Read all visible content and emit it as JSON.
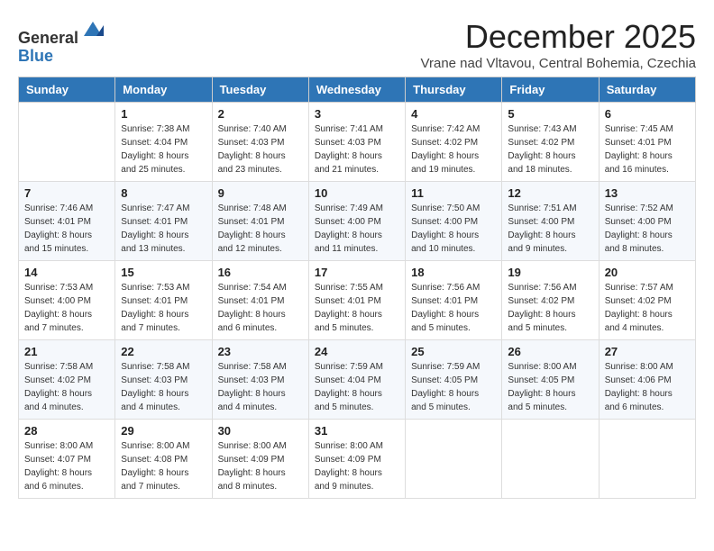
{
  "header": {
    "logo_line1": "General",
    "logo_line2": "Blue",
    "month_title": "December 2025",
    "subtitle": "Vrane nad Vltavou, Central Bohemia, Czechia"
  },
  "days_of_week": [
    "Sunday",
    "Monday",
    "Tuesday",
    "Wednesday",
    "Thursday",
    "Friday",
    "Saturday"
  ],
  "weeks": [
    [
      {
        "day": "",
        "info": ""
      },
      {
        "day": "1",
        "info": "Sunrise: 7:38 AM\nSunset: 4:04 PM\nDaylight: 8 hours\nand 25 minutes."
      },
      {
        "day": "2",
        "info": "Sunrise: 7:40 AM\nSunset: 4:03 PM\nDaylight: 8 hours\nand 23 minutes."
      },
      {
        "day": "3",
        "info": "Sunrise: 7:41 AM\nSunset: 4:03 PM\nDaylight: 8 hours\nand 21 minutes."
      },
      {
        "day": "4",
        "info": "Sunrise: 7:42 AM\nSunset: 4:02 PM\nDaylight: 8 hours\nand 19 minutes."
      },
      {
        "day": "5",
        "info": "Sunrise: 7:43 AM\nSunset: 4:02 PM\nDaylight: 8 hours\nand 18 minutes."
      },
      {
        "day": "6",
        "info": "Sunrise: 7:45 AM\nSunset: 4:01 PM\nDaylight: 8 hours\nand 16 minutes."
      }
    ],
    [
      {
        "day": "7",
        "info": "Sunrise: 7:46 AM\nSunset: 4:01 PM\nDaylight: 8 hours\nand 15 minutes."
      },
      {
        "day": "8",
        "info": "Sunrise: 7:47 AM\nSunset: 4:01 PM\nDaylight: 8 hours\nand 13 minutes."
      },
      {
        "day": "9",
        "info": "Sunrise: 7:48 AM\nSunset: 4:01 PM\nDaylight: 8 hours\nand 12 minutes."
      },
      {
        "day": "10",
        "info": "Sunrise: 7:49 AM\nSunset: 4:00 PM\nDaylight: 8 hours\nand 11 minutes."
      },
      {
        "day": "11",
        "info": "Sunrise: 7:50 AM\nSunset: 4:00 PM\nDaylight: 8 hours\nand 10 minutes."
      },
      {
        "day": "12",
        "info": "Sunrise: 7:51 AM\nSunset: 4:00 PM\nDaylight: 8 hours\nand 9 minutes."
      },
      {
        "day": "13",
        "info": "Sunrise: 7:52 AM\nSunset: 4:00 PM\nDaylight: 8 hours\nand 8 minutes."
      }
    ],
    [
      {
        "day": "14",
        "info": "Sunrise: 7:53 AM\nSunset: 4:00 PM\nDaylight: 8 hours\nand 7 minutes."
      },
      {
        "day": "15",
        "info": "Sunrise: 7:53 AM\nSunset: 4:01 PM\nDaylight: 8 hours\nand 7 minutes."
      },
      {
        "day": "16",
        "info": "Sunrise: 7:54 AM\nSunset: 4:01 PM\nDaylight: 8 hours\nand 6 minutes."
      },
      {
        "day": "17",
        "info": "Sunrise: 7:55 AM\nSunset: 4:01 PM\nDaylight: 8 hours\nand 5 minutes."
      },
      {
        "day": "18",
        "info": "Sunrise: 7:56 AM\nSunset: 4:01 PM\nDaylight: 8 hours\nand 5 minutes."
      },
      {
        "day": "19",
        "info": "Sunrise: 7:56 AM\nSunset: 4:02 PM\nDaylight: 8 hours\nand 5 minutes."
      },
      {
        "day": "20",
        "info": "Sunrise: 7:57 AM\nSunset: 4:02 PM\nDaylight: 8 hours\nand 4 minutes."
      }
    ],
    [
      {
        "day": "21",
        "info": "Sunrise: 7:58 AM\nSunset: 4:02 PM\nDaylight: 8 hours\nand 4 minutes."
      },
      {
        "day": "22",
        "info": "Sunrise: 7:58 AM\nSunset: 4:03 PM\nDaylight: 8 hours\nand 4 minutes."
      },
      {
        "day": "23",
        "info": "Sunrise: 7:58 AM\nSunset: 4:03 PM\nDaylight: 8 hours\nand 4 minutes."
      },
      {
        "day": "24",
        "info": "Sunrise: 7:59 AM\nSunset: 4:04 PM\nDaylight: 8 hours\nand 5 minutes."
      },
      {
        "day": "25",
        "info": "Sunrise: 7:59 AM\nSunset: 4:05 PM\nDaylight: 8 hours\nand 5 minutes."
      },
      {
        "day": "26",
        "info": "Sunrise: 8:00 AM\nSunset: 4:05 PM\nDaylight: 8 hours\nand 5 minutes."
      },
      {
        "day": "27",
        "info": "Sunrise: 8:00 AM\nSunset: 4:06 PM\nDaylight: 8 hours\nand 6 minutes."
      }
    ],
    [
      {
        "day": "28",
        "info": "Sunrise: 8:00 AM\nSunset: 4:07 PM\nDaylight: 8 hours\nand 6 minutes."
      },
      {
        "day": "29",
        "info": "Sunrise: 8:00 AM\nSunset: 4:08 PM\nDaylight: 8 hours\nand 7 minutes."
      },
      {
        "day": "30",
        "info": "Sunrise: 8:00 AM\nSunset: 4:09 PM\nDaylight: 8 hours\nand 8 minutes."
      },
      {
        "day": "31",
        "info": "Sunrise: 8:00 AM\nSunset: 4:09 PM\nDaylight: 8 hours\nand 9 minutes."
      },
      {
        "day": "",
        "info": ""
      },
      {
        "day": "",
        "info": ""
      },
      {
        "day": "",
        "info": ""
      }
    ]
  ]
}
